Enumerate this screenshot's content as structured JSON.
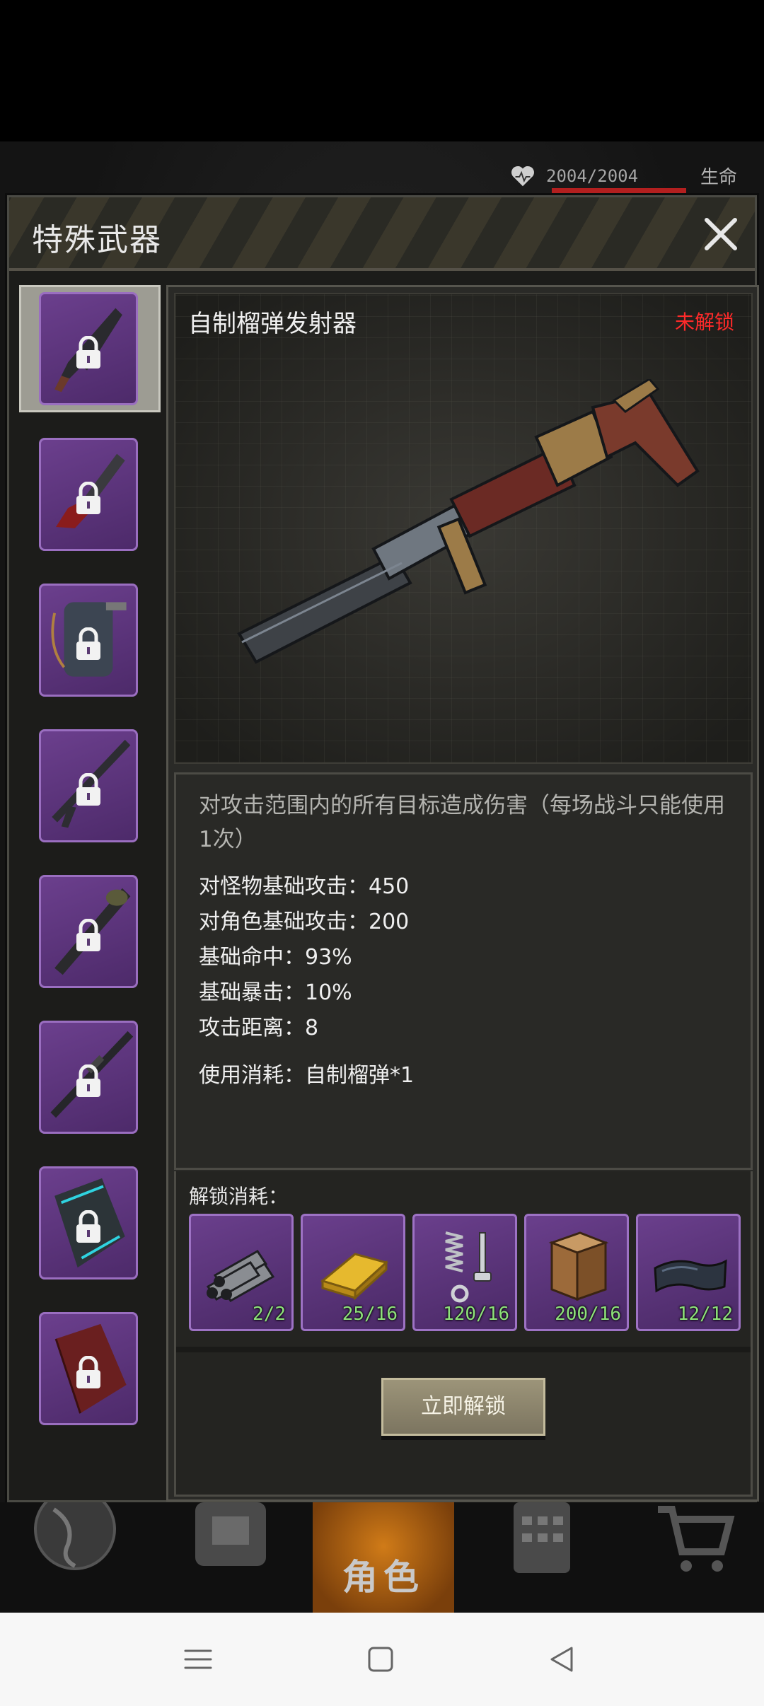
{
  "status": {
    "hp_text": "2004/2004",
    "hp_label": "生命"
  },
  "dialog": {
    "title": "特殊武器",
    "weapon_name": "自制榴弹发射器",
    "lock_status": "未解锁",
    "description": "对攻击范围内的所有目标造成伤害（每场战斗只能使用1次）",
    "stats": [
      "对怪物基础攻击：450",
      "对角色基础攻击：200",
      "基础命中：93%",
      "基础暴击：10%",
      "攻击距离：8"
    ],
    "consume": "使用消耗：自制榴弹*1",
    "unlock_label": "解锁消耗：",
    "materials": [
      {
        "icon": "pipes-icon",
        "count": "2/2"
      },
      {
        "icon": "gold-bar-icon",
        "count": "25/16"
      },
      {
        "icon": "spring-bolt-icon",
        "count": "120/16"
      },
      {
        "icon": "wood-block-icon",
        "count": "200/16"
      },
      {
        "icon": "cloth-icon",
        "count": "12/12"
      }
    ],
    "unlock_button": "立即解锁"
  },
  "weapons": [
    "grenade-launcher-icon",
    "chainsaw-icon",
    "flamethrower-pack-icon",
    "rifle-icon",
    "rocket-launcher-icon",
    "sniper-rifle-icon",
    "cyan-crate-icon",
    "red-crate-icon"
  ],
  "tabs": {
    "role_label": "角色"
  },
  "colors": {
    "locked": "#ff2a2a",
    "slot_purple": "#6b3f8d",
    "count_green": "#8ee27a"
  }
}
